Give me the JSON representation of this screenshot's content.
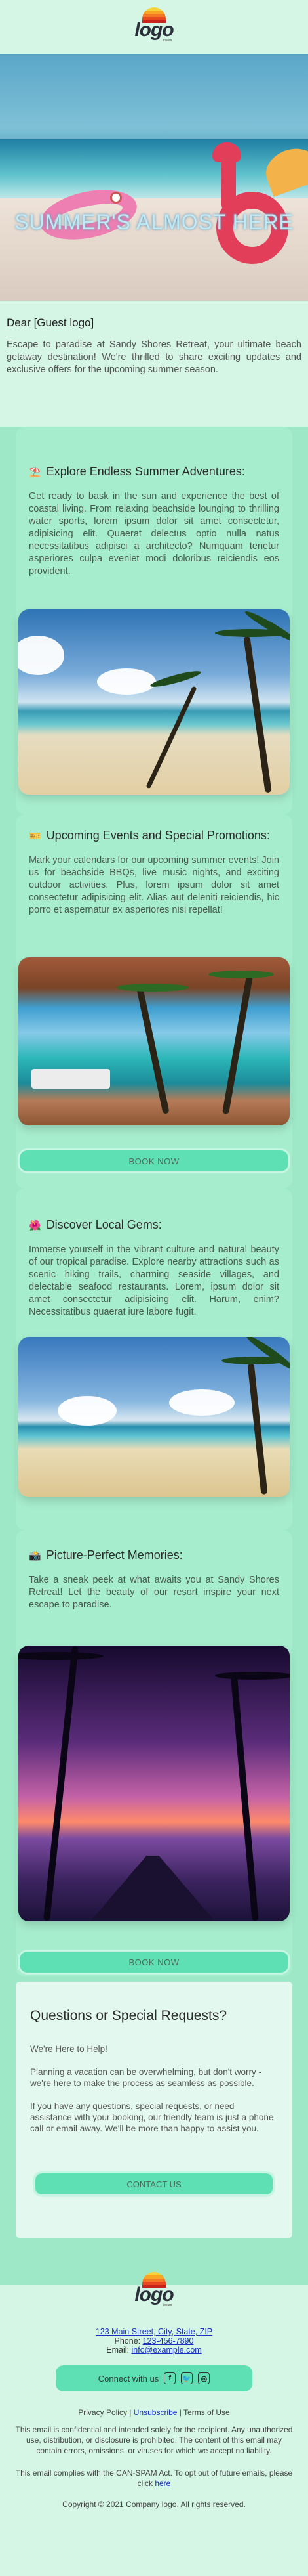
{
  "header": {
    "logo_word": "logo",
    "logo_sub": "ipsum"
  },
  "hero": {
    "title": "SUMMER'S ALMOST HERE"
  },
  "intro": {
    "greeting": "Dear [Guest logo]",
    "text": "Escape to paradise at Sandy Shores Retreat, your ultimate beach getaway destination! We're thrilled to share exciting updates and exclusive offers for the upcoming summer season."
  },
  "sections": [
    {
      "emoji": "⛱️",
      "title": "Explore Endless Summer Adventures:",
      "text": "Get ready to bask in the sun and experience the best of coastal living. From relaxing beachside lounging to thrilling water sports, lorem ipsum dolor sit amet consectetur, adipisicing elit. Quaerat delectus optio nulla natus necessitatibus adipisci a architecto? Numquam tenetur asperiores culpa eveniet modi doloribus reiciendis eos provident."
    },
    {
      "emoji": "🎫",
      "title": "Upcoming Events and Special Promotions:",
      "text": "Mark your calendars for our upcoming summer events! Join us for beachside BBQs, live music nights, and exciting outdoor activities. Plus, lorem ipsum dolor sit amet consectetur adipisicing elit. Alias aut deleniti reiciendis, hic porro et aspernatur ex asperiores nisi repellat!",
      "button": "BOOK NOW"
    },
    {
      "emoji": "🌺",
      "title": "Discover Local Gems:",
      "text": "Immerse yourself in the vibrant culture and natural beauty of our tropical paradise. Explore nearby attractions such as scenic hiking trails, charming seaside villages, and delectable seafood restaurants. Lorem, ipsum dolor sit amet consectetur adipisicing elit. Harum, enim? Necessitatibus quaerat iure labore fugit."
    },
    {
      "emoji": "📸",
      "title": "Picture-Perfect Memories:",
      "text": "Take a sneak peek at what awaits you at Sandy Shores Retreat! Let the beauty of our resort inspire your next escape to paradise.",
      "button": "BOOK NOW"
    }
  ],
  "questions": {
    "title": "Questions or Special Requests?",
    "subtitle": "We're Here to Help!",
    "p1": "Planning a vacation can be overwhelming, but don't worry - we're here to make the process as seamless as possible.",
    "p2": "If you have any questions, special requests, or need assistance with your booking, our friendly team is just a phone call or email away. We'll be more than happy to assist you.",
    "button": "CONTACT US"
  },
  "footer": {
    "address": "123 Main Street, City, State, ZIP",
    "phone_label": "Phone: ",
    "phone": "123-456-7890",
    "email_label": "Email: ",
    "email": "info@example.com",
    "connect": "Connect with us",
    "social": [
      "f",
      "t",
      "ig"
    ],
    "privacy": "Privacy Policy",
    "sep": " | ",
    "unsubscribe": "Unsubscribe",
    "terms": "Terms of Use",
    "confidential": "This email is confidential and intended solely for the recipient. Any unauthorized use, distribution, or disclosure is prohibited. The content of this email may contain errors, omissions, or viruses for which we accept no liability.",
    "canspam": "This email complies with the CAN-SPAM Act. To opt out of future emails, please click ",
    "here": "here",
    "copyright": "Copyright © 2021 Company logo. All rights reserved."
  },
  "colors": {
    "background": "#d5f6e5",
    "band": "#9ee8c8",
    "button": "#5ee0b4",
    "link": "#1a2fc4"
  }
}
